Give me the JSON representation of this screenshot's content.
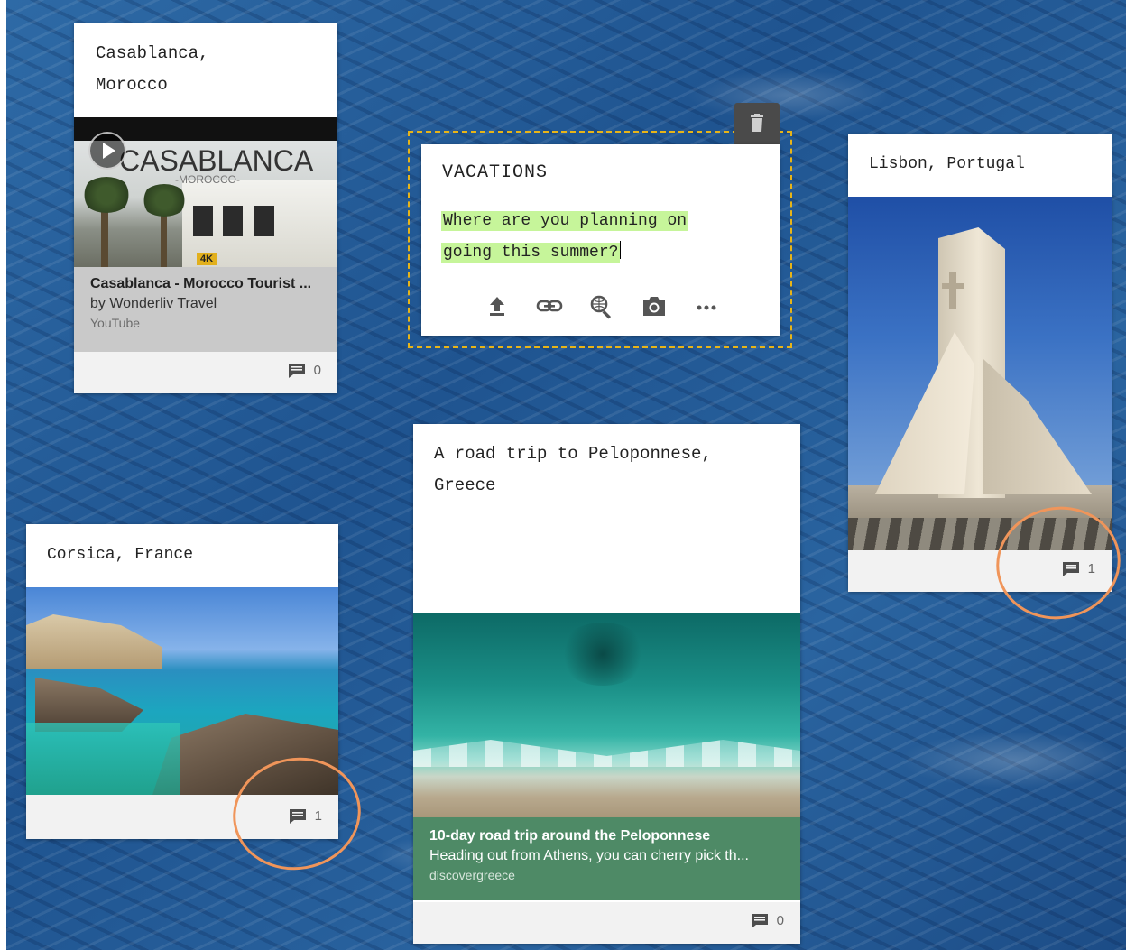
{
  "board": {
    "cards": {
      "casablanca": {
        "title": "Casablanca,\nMorocco",
        "video_overlay_text": "CASABLANCA",
        "video_overlay_sub": "-MOROCCO-",
        "badge": "4K",
        "link_title": "Casablanca - Morocco Tourist ...",
        "link_sub": "by Wonderliv Travel",
        "link_source": "YouTube",
        "comment_icon": "comment-icon",
        "comment_count": "0"
      },
      "vacations": {
        "title": "VACATIONS",
        "body": "Where are you planning on\ngoing this summer?",
        "toolbar": {
          "upload_icon": "upload-icon",
          "link_icon": "link-icon",
          "search_icon": "search-icon",
          "camera_icon": "camera-icon",
          "more_icon": "more-icon"
        },
        "delete_icon": "trash-icon"
      },
      "lisbon": {
        "title": "Lisbon, Portugal",
        "comment_icon": "comment-icon",
        "comment_count": "1"
      },
      "corsica": {
        "title": "Corsica, France",
        "comment_icon": "comment-icon",
        "comment_count": "1"
      },
      "peloponnese": {
        "title": "A road trip to Peloponnese,\nGreece",
        "link_title": "10-day road trip around the Peloponnese",
        "link_sub": "Heading out from Athens, you can cherry pick th...",
        "link_source": "discovergreece",
        "comment_icon": "comment-icon",
        "comment_count": "0"
      }
    }
  },
  "colors": {
    "highlight": "#c6f59a",
    "selection_border": "#e7b418",
    "annotation_circle": "#f0955a",
    "link_preview_green": "#4e8a66",
    "link_preview_gray": "#c8c8c8"
  }
}
